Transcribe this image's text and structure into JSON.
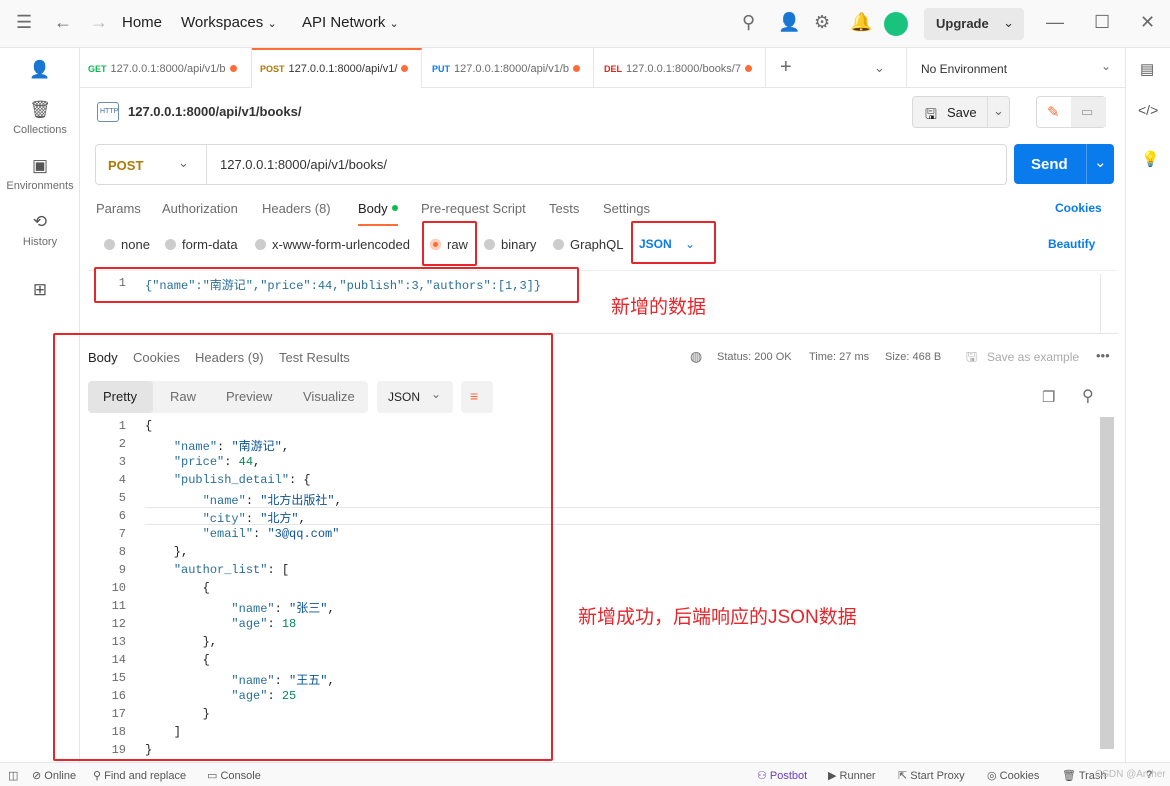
{
  "titlebar": {
    "home": "Home",
    "workspaces": "Workspaces",
    "api_network": "API Network",
    "upgrade": "Upgrade"
  },
  "sidebar": {
    "items": [
      {
        "label": "Collections",
        "icon": "trash-icon"
      },
      {
        "label": "Environments",
        "icon": "environment-icon"
      },
      {
        "label": "History",
        "icon": "history-icon"
      }
    ]
  },
  "tabs": [
    {
      "method": "GET",
      "url": "127.0.0.1:8000/api/v1/b",
      "color": "#0cbb52"
    },
    {
      "method": "POST",
      "url": "127.0.0.1:8000/api/v1/",
      "color": "#ad7a03"
    },
    {
      "method": "PUT",
      "url": "127.0.0.1:8000/api/v1/b",
      "color": "#097bed"
    },
    {
      "method": "DEL",
      "url": "127.0.0.1:8000/books/7",
      "color": "#eb2013"
    }
  ],
  "environment": "No Environment",
  "request": {
    "title": "127.0.0.1:8000/api/v1/books/",
    "save": "Save",
    "method": "POST",
    "url": "127.0.0.1:8000/api/v1/books/",
    "send": "Send",
    "subtabs": [
      "Params",
      "Authorization",
      "Headers (8)",
      "Body",
      "Pre-request Script",
      "Tests",
      "Settings"
    ],
    "cookies": "Cookies",
    "body_types": [
      "none",
      "form-data",
      "x-www-form-urlencoded",
      "raw",
      "binary",
      "GraphQL"
    ],
    "format": "JSON",
    "beautify": "Beautify",
    "line_no": "1",
    "body": "{\"name\":\"南游记\",\"price\":44,\"publish\":3,\"authors\":[1,3]}"
  },
  "annotations": {
    "new_data": "新增的数据",
    "success": "新增成功，后端响应的JSON数据"
  },
  "response": {
    "tabs": [
      "Body",
      "Cookies",
      "Headers (9)",
      "Test Results"
    ],
    "status": "Status: 200 OK",
    "time": "Time: 27 ms",
    "size": "Size: 468 B",
    "save_example": "Save as example",
    "views": [
      "Pretty",
      "Raw",
      "Preview",
      "Visualize"
    ],
    "format": "JSON",
    "lines": [
      "{",
      "    \"name\": \"南游记\",",
      "    \"price\": 44,",
      "    \"publish_detail\": {",
      "        \"name\": \"北方出版社\",",
      "        \"city\": \"北方\",",
      "        \"email\": \"3@qq.com\"",
      "    },",
      "    \"author_list\": [",
      "        {",
      "            \"name\": \"张三\",",
      "            \"age\": 18",
      "        },",
      "        {",
      "            \"name\": \"王五\",",
      "            \"age\": 25",
      "        }",
      "    ]",
      "}"
    ]
  },
  "statusbar": {
    "online": "Online",
    "find": "Find and replace",
    "console": "Console",
    "postbot": "Postbot",
    "runner": "Runner",
    "proxy": "Start Proxy",
    "cookies": "Cookies",
    "trash": "Trash",
    "watermark": "CSDN @Archer"
  },
  "colors": {
    "accent": "#ff6c37",
    "send": "#097bed",
    "annotation": "#e5262b"
  }
}
